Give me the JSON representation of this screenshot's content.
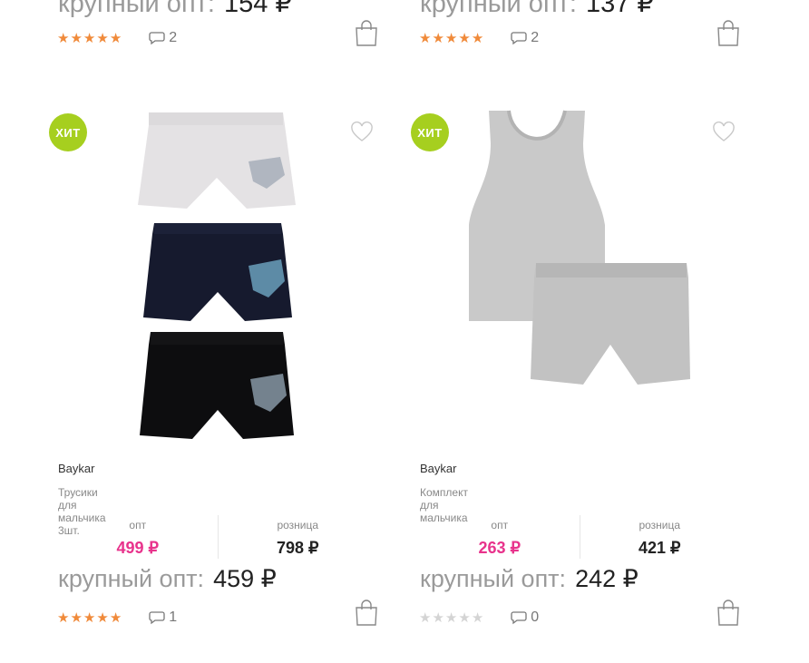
{
  "top_row": [
    {
      "bulk_label": "крупный опт:",
      "bulk_price": "154 ₽",
      "comments": "2"
    },
    {
      "bulk_label": "крупный опт:",
      "bulk_price": "137 ₽",
      "comments": "2"
    }
  ],
  "products": [
    {
      "badge": "ХИТ",
      "brand": "Baykar",
      "name": "Трусики для мальчика 3шт.",
      "opt_label": "опт",
      "opt_price": "499 ₽",
      "retail_label": "розница",
      "retail_price": "798 ₽",
      "bulk_label": "крупный опт:",
      "bulk_price": "459 ₽",
      "rating": 5,
      "comments": "1"
    },
    {
      "badge": "ХИТ",
      "brand": "Baykar",
      "name": "Комплект для мальчика",
      "opt_label": "опт",
      "opt_price": "263 ₽",
      "retail_label": "розница",
      "retail_price": "421 ₽",
      "bulk_label": "крупный опт:",
      "bulk_price": "242 ₽",
      "rating": 0,
      "comments": "0"
    }
  ],
  "colors": {
    "accent_orange": "#f08a3a",
    "hit_green": "#a6cf1f",
    "opt_pink": "#e8338c"
  },
  "icons": [
    "star-icon",
    "comment-icon",
    "cart-icon",
    "heart-icon"
  ]
}
